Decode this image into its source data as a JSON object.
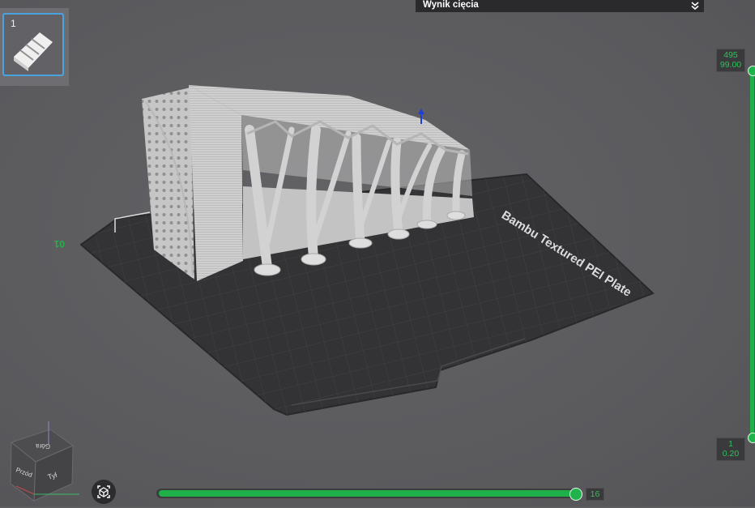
{
  "window": {
    "title": ""
  },
  "plates": [
    {
      "number": "1",
      "selected": true
    }
  ],
  "result_panel": {
    "title": "Wynik cięcia",
    "toggle_icon": "double-chevron-down-icon"
  },
  "bed": {
    "label": "Bambu Textured PEI Plate",
    "plate_id": "01"
  },
  "layer_slider": {
    "top": {
      "layer": "495",
      "height": "99.00"
    },
    "bottom": {
      "layer": "1",
      "height": "0.20"
    }
  },
  "move_slider": {
    "value": "16",
    "fraction": 0.99
  },
  "view_cube": {
    "front": "Przód",
    "back": "Tył",
    "top": "Góra"
  },
  "colors": {
    "accent": "#1fb04a",
    "background": "#5d5d60",
    "panel_dark": "#2a2a2c",
    "selection": "#4aa3df",
    "bed": "#333335",
    "model": "#c9c9c9"
  }
}
